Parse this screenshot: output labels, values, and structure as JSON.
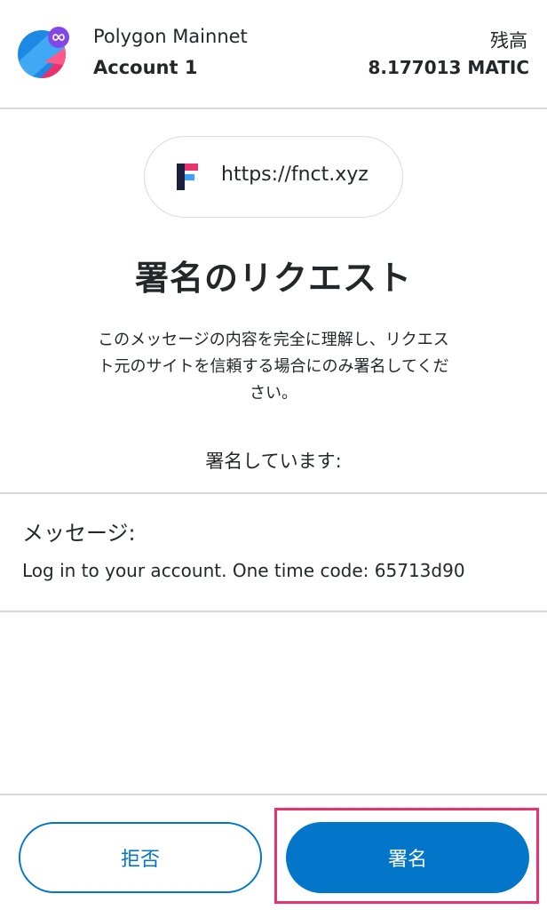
{
  "header": {
    "network_name": "Polygon Mainnet",
    "account_name": "Account 1",
    "balance_label": "残高",
    "balance_value": "8.177013 MATIC"
  },
  "origin": {
    "url": "https://fnct.xyz",
    "logo_icon": "fnct-logo-icon"
  },
  "request": {
    "title": "署名のリクエスト",
    "description_line1": "このメッセージの内容を完全に理解し、リクエス",
    "description_line2": "ト元のサイトを信頼する場合にのみ署名してくだ",
    "description_line3": "さい。",
    "signing_label": "署名しています:"
  },
  "message": {
    "label": "メッセージ:",
    "text": "Log in to your account. One time code: 65713d90"
  },
  "footer": {
    "reject_label": "拒否",
    "sign_label": "署名"
  },
  "colors": {
    "primary": "#0376c9",
    "highlight": "#e8336e",
    "polygon_purple": "#8247e5"
  }
}
